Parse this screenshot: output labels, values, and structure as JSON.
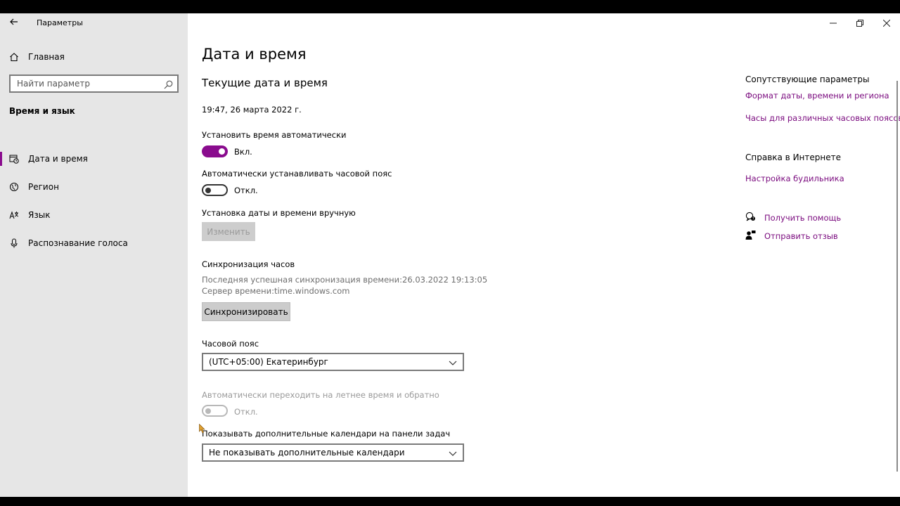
{
  "window": {
    "title": "Параметры",
    "buttons": {
      "minimize": "─",
      "restore": "❐",
      "close": "✕"
    }
  },
  "sidebar": {
    "home_label": "Главная",
    "search_placeholder": "Найти параметр",
    "section_title": "Время и язык",
    "items": [
      {
        "label": "Дата и время",
        "icon": "calendar-clock-icon",
        "selected": true
      },
      {
        "label": "Регион",
        "icon": "globe-icon",
        "selected": false
      },
      {
        "label": "Язык",
        "icon": "language-icon",
        "selected": false
      },
      {
        "label": "Распознавание голоса",
        "icon": "microphone-icon",
        "selected": false
      }
    ]
  },
  "main": {
    "title": "Дата и время",
    "subtitle": "Текущие дата и время",
    "current_datetime": "19:47, 26 марта 2022 г.",
    "auto_time": {
      "label": "Установить время автоматически",
      "state": "Вкл."
    },
    "auto_timezone": {
      "label": "Автоматически устанавливать часовой пояс",
      "state": "Откл."
    },
    "manual": {
      "label": "Установка даты и времени вручную",
      "button": "Изменить"
    },
    "sync": {
      "heading": "Синхронизация часов",
      "last_sync": "Последняя успешная синхронизация времени:26.03.2022 19:13:05",
      "server": "Сервер времени:time.windows.com",
      "button": "Синхронизировать"
    },
    "timezone": {
      "label": "Часовой пояс",
      "value": "(UTC+05:00) Екатеринбург"
    },
    "dst": {
      "label": "Автоматически переходить на летнее время и обратно",
      "state": "Откл."
    },
    "calendars": {
      "label": "Показывать дополнительные календари на панели задач",
      "value": "Не показывать дополнительные календари"
    }
  },
  "related": {
    "heading": "Сопутствующие параметры",
    "links": [
      "Формат даты, времени и региона",
      "Часы для различных часовых поясов"
    ]
  },
  "help": {
    "heading": "Справка в Интернете",
    "link": "Настройка будильника"
  },
  "actions": {
    "get_help": "Получить помощь",
    "feedback": "Отправить отзыв"
  },
  "colors": {
    "accent": "#8a0c8e",
    "link": "#7a0a7e",
    "sidebar_bg": "#e6e6e6"
  }
}
